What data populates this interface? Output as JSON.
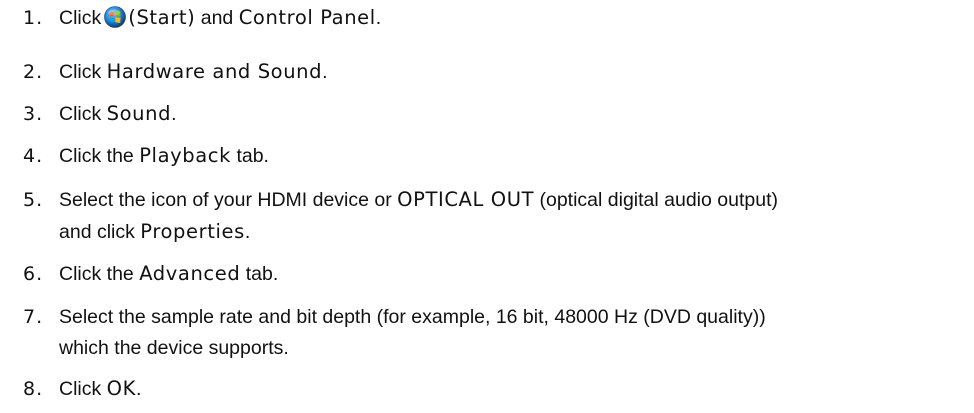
{
  "steps": [
    {
      "num": "1.",
      "t1": "Click",
      "t2": "(Start)",
      "t3": "and",
      "t4": "Control Panel",
      "t5": "."
    },
    {
      "num": "2.",
      "t1": "Click",
      "t2": "Hardware and Sound",
      "t3": "."
    },
    {
      "num": "3.",
      "t1": "Click",
      "t2": "Sound",
      "t3": "."
    },
    {
      "num": "4.",
      "t1": "Click the",
      "t2": "Playback",
      "t3": "tab."
    },
    {
      "num": "5.",
      "t1": "Select the icon of your HDMI device or",
      "t2": "OPTICAL OUT",
      "t3": "(optical digital audio output)",
      "t4": "and click",
      "t5": "Properties",
      "t6": "."
    },
    {
      "num": "6.",
      "t1": "Click the",
      "t2": "Advanced",
      "t3": "tab."
    },
    {
      "num": "7.",
      "t1": "Select the sample rate and bit depth (for example, 16 bit, 48000 Hz (DVD quality))",
      "t2": "which the device supports."
    },
    {
      "num": "8.",
      "t1": "Click",
      "t2": "OK",
      "t3": "."
    }
  ],
  "icons": {
    "start": "windows-start-orb-icon"
  },
  "colors": {
    "text": "#111111",
    "background": "#ffffff"
  }
}
